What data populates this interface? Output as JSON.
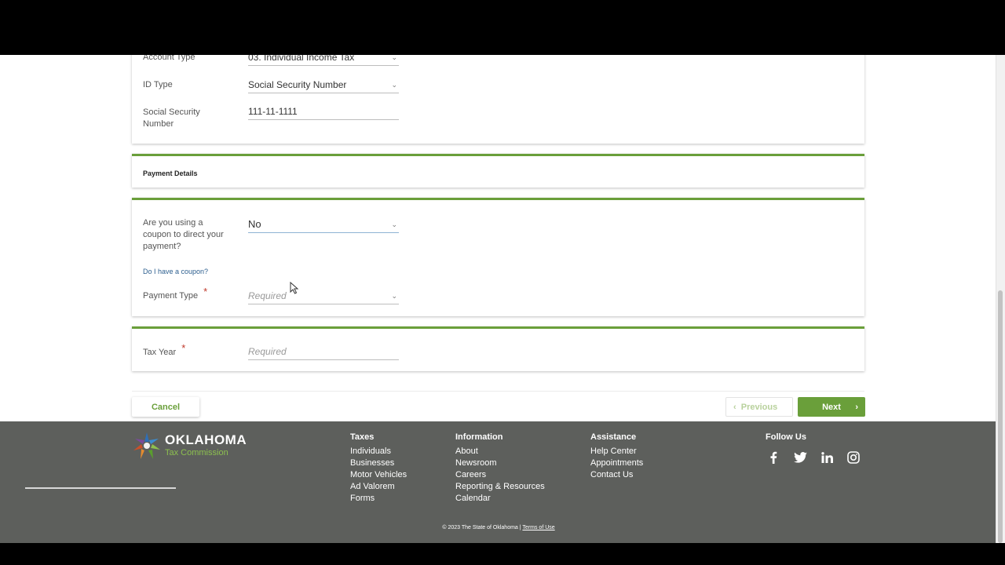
{
  "account": {
    "account_type_label": "Account Type",
    "account_type_value": "03. Individual Income Tax",
    "id_type_label": "ID Type",
    "id_type_value": "Social Security Number",
    "ssn_label": "Social Security Number",
    "ssn_value": "111-11-1111"
  },
  "payment_details": {
    "title": "Payment Details"
  },
  "coupon": {
    "question": "Are you using a coupon to direct your payment?",
    "value": "No",
    "help_link": "Do I have a coupon?",
    "payment_type_label": "Payment Type",
    "payment_type_placeholder": "Required",
    "required_mark": "*"
  },
  "tax_year": {
    "label": "Tax Year",
    "placeholder": "Required",
    "required_mark": "*"
  },
  "buttons": {
    "cancel": "Cancel",
    "previous": "Previous",
    "previous_icon": "chevron-left-icon",
    "next": "Next",
    "next_icon": "chevron-right-icon"
  },
  "footer": {
    "logo_main": "OKLAHOMA",
    "logo_sub": "Tax Commission",
    "taxes": {
      "title": "Taxes",
      "links": [
        "Individuals",
        "Businesses",
        "Motor Vehicles",
        "Ad Valorem",
        "Forms"
      ]
    },
    "information": {
      "title": "Information",
      "links": [
        "About",
        "Newsroom",
        "Careers",
        "Reporting & Resources",
        "Calendar"
      ]
    },
    "assistance": {
      "title": "Assistance",
      "links": [
        "Help Center",
        "Appointments",
        "Contact Us"
      ]
    },
    "follow": {
      "title": "Follow Us",
      "icons": [
        "facebook-icon",
        "twitter-icon",
        "linkedin-icon",
        "instagram-icon"
      ]
    },
    "copyright": "© 2023 The State of Oklahoma |",
    "terms": "Terms of Use"
  },
  "colors": {
    "accent_green": "#6a9f3a",
    "footer_bg": "#5d5f5c",
    "required_red": "#c0392b"
  }
}
